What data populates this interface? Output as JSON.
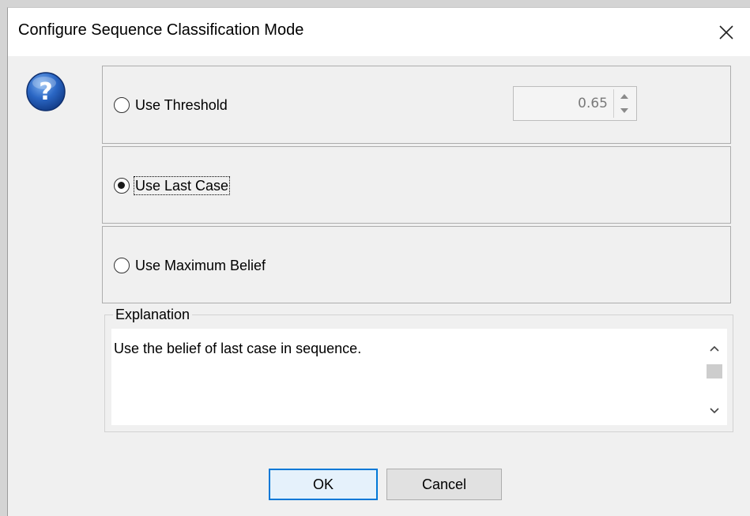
{
  "window": {
    "title": "Configure Sequence Classification Mode",
    "close_icon": "close-icon"
  },
  "help_icon": "question-mark-icon",
  "options": [
    {
      "label": "Use Threshold",
      "selected": false
    },
    {
      "label": "Use Last Case",
      "selected": true,
      "focused": true
    },
    {
      "label": "Use Maximum Belief",
      "selected": false
    }
  ],
  "threshold": {
    "value": "0.65",
    "enabled": false
  },
  "explanation": {
    "legend": "Explanation",
    "text": "Use the belief of last case in sequence."
  },
  "buttons": {
    "ok": "OK",
    "cancel": "Cancel"
  },
  "colors": {
    "accent": "#0078d7",
    "dialog_bg": "#f0f0f0",
    "help_icon": "#1f5bb0"
  }
}
